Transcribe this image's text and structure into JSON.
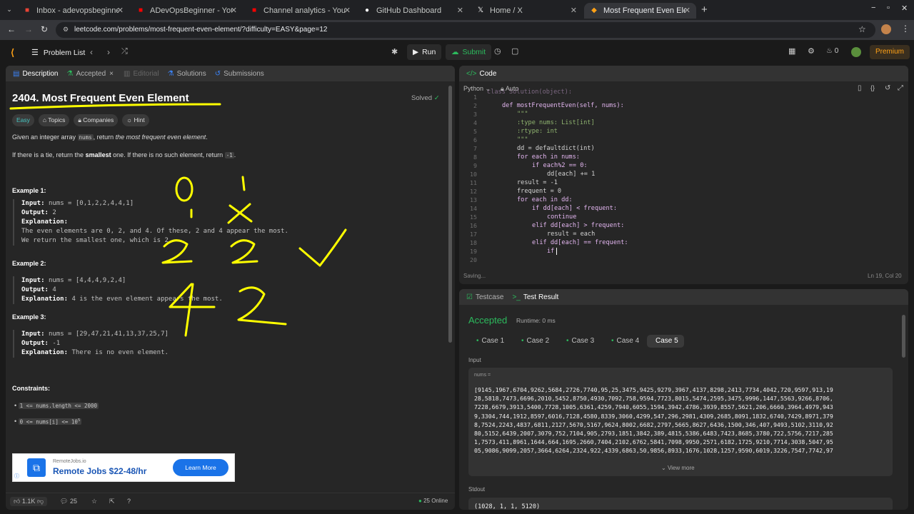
{
  "browser": {
    "tabs": [
      {
        "title": "Inbox - adevopsbeginne",
        "icon": "gmail-icon",
        "color": "#ea4335"
      },
      {
        "title": "ADevOpsBeginner - YouT",
        "icon": "youtube-icon",
        "color": "#ff0000"
      },
      {
        "title": "Channel analytics - YouT",
        "icon": "youtube-icon",
        "color": "#ff0000"
      },
      {
        "title": "GitHub Dashboard",
        "icon": "github-icon",
        "color": "#ffffff"
      },
      {
        "title": "Home / X",
        "icon": "x-icon",
        "color": "#ffffff"
      },
      {
        "title": "Most Frequent Even Elem",
        "icon": "leetcode-icon",
        "color": "#ffa116"
      }
    ],
    "url": "leetcode.com/problems/most-frequent-even-element/?difficulty=EASY&page=12"
  },
  "toolbar": {
    "problem_list": "Problem List",
    "run": "Run",
    "submit": "Submit",
    "streak": "0",
    "premium": "Premium"
  },
  "left_tabs": {
    "description": "Description",
    "accepted": "Accepted",
    "editorial": "Editorial",
    "solutions": "Solutions",
    "submissions": "Submissions"
  },
  "problem": {
    "title": "2404. Most Frequent Even Element",
    "solved": "Solved",
    "difficulty": "Easy",
    "topics": "Topics",
    "companies": "Companies",
    "hint": "Hint",
    "desc1_a": "Given an integer array ",
    "desc1_code": "nums",
    "desc1_b": ", return ",
    "desc1_em": "the most frequent even element",
    "desc2_a": "If there is a tie, return the ",
    "desc2_strong": "smallest",
    "desc2_b": " one. If there is no such element, return ",
    "desc2_code": "-1",
    "ex1_title": "Example 1:",
    "ex1_input": "nums = [0,1,2,2,4,4,1]",
    "ex1_output": "2",
    "ex1_expl_1": "The even elements are 0, 2, and 4. Of these, 2 and 4 appear the most.",
    "ex1_expl_2": "We return the smallest one, which is 2.",
    "ex2_title": "Example 2:",
    "ex2_input": "nums = [4,4,4,9,2,4]",
    "ex2_output": "4",
    "ex2_expl": "4 is the even element appears the most.",
    "ex3_title": "Example 3:",
    "ex3_input": "nums = [29,47,21,41,13,37,25,7]",
    "ex3_output": "-1",
    "ex3_expl": "There is no even element.",
    "input_label": "Input:",
    "output_label": "Output:",
    "expl_label": "Explanation:",
    "constraints_title": "Constraints:",
    "c1": "1 <= nums.length <= 2000",
    "c2": "0 <= nums[i] <= 10",
    "c2_sup": "5"
  },
  "ad": {
    "source": "RemoteJobs.io",
    "title": "Remote Jobs $22-48/hr",
    "button": "Learn More"
  },
  "footer": {
    "likes": "1.1K",
    "comments": "25",
    "online": "25 Online"
  },
  "code_panel": {
    "title": "Code",
    "lang": "Python",
    "auto": "Auto",
    "status": "Saving...",
    "cursor": "Ln 19, Col 20"
  },
  "code_lines": [
    "class Solution(object):",
    "def mostFrequentEven(self, nums):",
    "\"\"\"",
    ":type nums: List[int]",
    ":rtype: int",
    "\"\"\"",
    "dd = defaultdict(int)",
    "for each in nums:",
    "if each%2 == 0:",
    "dd[each] += 1",
    "result = -1",
    "frequent = 0",
    "for each in dd:",
    "if dd[each] < frequent:",
    "continue",
    "elif dd[each] > frequent:",
    "result = each",
    "elif dd[each] == frequent:",
    "if ",
    ""
  ],
  "result_panel": {
    "testcase_tab": "Testcase",
    "result_tab": "Test Result",
    "status": "Accepted",
    "runtime": "Runtime: 0 ms",
    "cases": [
      "Case 1",
      "Case 2",
      "Case 3",
      "Case 4",
      "Case 5"
    ],
    "input_label": "Input",
    "var_label": "nums =",
    "nums_lines": [
      "[9145,1967,6704,9262,5684,2726,7740,95,25,3475,9425,9279,3967,4137,8298,2413,7734,4042,720,9597,913,19",
      "28,5818,7473,6696,2010,5452,8750,4930,7092,758,9594,7723,8015,5474,2595,3475,9996,1447,5563,9266,8706,",
      "7228,6679,3913,5400,7728,1005,6361,4259,7940,6055,1594,3942,4786,3939,8557,5621,206,6660,3964,4979,943",
      "9,3304,744,1912,8597,6016,7128,4580,8339,3060,4299,547,296,2981,4309,2685,8091,1832,6740,7429,8971,379",
      "8,7524,2243,4837,6811,2127,5670,5167,9624,8002,6682,2797,5665,8627,6436,1500,346,407,9493,5102,3110,92",
      "80,5152,6439,2007,3079,752,7104,905,2793,1851,3842,389,4815,5386,6483,7423,8685,3780,722,5756,7217,285",
      "1,7573,411,8961,1644,664,1695,2660,7404,2102,6762,5841,7098,9950,2571,6182,1725,9210,7714,3038,5047,95",
      "05,9086,9099,2057,3664,6264,2324,922,4339,6863,50,9856,8933,1676,1028,1257,9590,6019,3226,7547,7742,97"
    ],
    "view_more": "View more",
    "stdout_label": "Stdout",
    "stdout": "(1028, 1, 1, 5120)"
  },
  "annotation": {
    "color": "#ffff00"
  }
}
